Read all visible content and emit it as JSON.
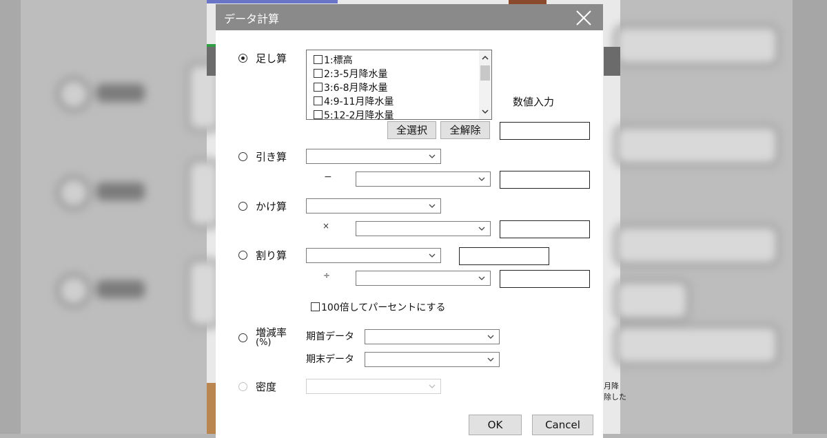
{
  "dialog": {
    "title": "データ計算",
    "close_icon": "close-icon"
  },
  "addition": {
    "label": "足し算",
    "selected": true,
    "items": [
      "1:標高",
      "2:3-5月降水量",
      "3:6-8月降水量",
      "4:9-11月降水量",
      "5:12-2月降水量"
    ],
    "select_all": "全選択",
    "clear_all": "全解除",
    "numeric_input_label": "数値入力"
  },
  "subtraction": {
    "label": "引き算",
    "operator": "−"
  },
  "multiplication": {
    "label": "かけ算",
    "operator": "×"
  },
  "division": {
    "label": "割り算",
    "operator": "÷"
  },
  "percent_checkbox": {
    "label": "100倍してパーセントにする",
    "checked": false
  },
  "growth_rate": {
    "label_line1": "増減率",
    "label_line2": "(%)",
    "start_label": "期首データ",
    "end_label": "期末データ"
  },
  "density": {
    "label": "密度",
    "disabled": true
  },
  "buttons": {
    "ok": "OK",
    "cancel": "Cancel"
  },
  "background": {
    "text1": "月降",
    "text2": "除した"
  }
}
